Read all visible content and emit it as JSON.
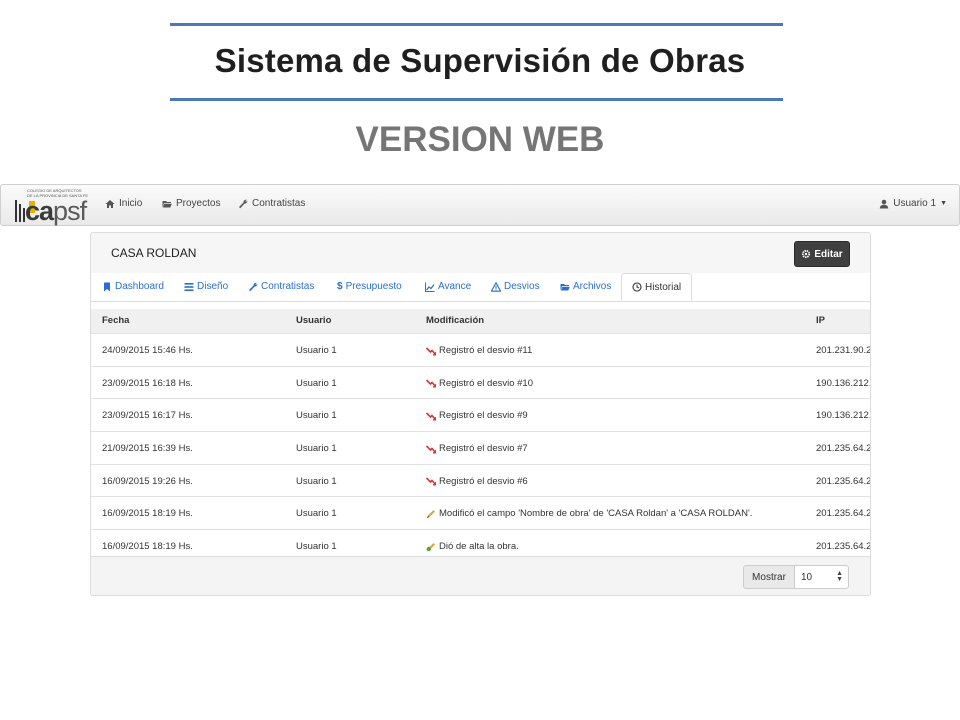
{
  "slide": {
    "title": "Sistema de Supervisión de Obras",
    "subtitle": "VERSION WEB"
  },
  "navbar": {
    "logo_text_main": "ca",
    "logo_text_sub": "psf",
    "logo_small_1": "COLEGIO DE ARQUITECTOS",
    "logo_small_2": "DE LA PROVINCIA DE SANTA FE",
    "items": [
      {
        "label": "Inicio",
        "icon": "home-icon"
      },
      {
        "label": "Proyectos",
        "icon": "folder-open-icon"
      },
      {
        "label": "Contratistas",
        "icon": "wrench-icon"
      }
    ],
    "user_label": "Usuario 1"
  },
  "panel": {
    "project_name": "CASA ROLDAN",
    "edit_label": "Editar",
    "tabs": [
      {
        "label": "Dashboard",
        "icon": "bookmark-icon"
      },
      {
        "label": "Diseño",
        "icon": "list-icon"
      },
      {
        "label": "Contratistas",
        "icon": "wrench-icon"
      },
      {
        "label": "Presupuesto",
        "icon": "dollar-icon"
      },
      {
        "label": "Avance",
        "icon": "chart-line-icon"
      },
      {
        "label": "Desvios",
        "icon": "warning-icon"
      },
      {
        "label": "Archivos",
        "icon": "folder-open-icon"
      },
      {
        "label": "Historial",
        "icon": "clock-icon"
      }
    ],
    "active_tab": "Historial",
    "table": {
      "headers": [
        "Fecha",
        "Usuario",
        "Modificación",
        "IP"
      ],
      "rows": [
        {
          "fecha": "24/09/2015 15:46 Hs.",
          "usuario": "Usuario 1",
          "modificacion": "Registró el desvio #11",
          "ip": "201.231.90.2",
          "icon": "desvio-icon"
        },
        {
          "fecha": "23/09/2015 16:18 Hs.",
          "usuario": "Usuario 1",
          "modificacion": "Registró el desvio #10",
          "ip": "190.136.212.",
          "icon": "desvio-icon"
        },
        {
          "fecha": "23/09/2015 16:17 Hs.",
          "usuario": "Usuario 1",
          "modificacion": "Registró el desvio #9",
          "ip": "190.136.212.",
          "icon": "desvio-icon"
        },
        {
          "fecha": "21/09/2015 16:39 Hs.",
          "usuario": "Usuario 1",
          "modificacion": "Registró el desvio #7",
          "ip": "201.235.64.2",
          "icon": "desvio-icon"
        },
        {
          "fecha": "16/09/2015 19:26 Hs.",
          "usuario": "Usuario 1",
          "modificacion": "Registró el desvio #6",
          "ip": "201.235.64.2",
          "icon": "desvio-icon"
        },
        {
          "fecha": "16/09/2015 18:19 Hs.",
          "usuario": "Usuario 1",
          "modificacion": "Modificó el campo 'Nombre de obra' de 'CASA Roldan' a 'CASA ROLDAN'.",
          "ip": "201.235.64.2",
          "icon": "pencil-icon"
        },
        {
          "fecha": "16/09/2015 18:19 Hs.",
          "usuario": "Usuario 1",
          "modificacion": "Dió de alta la obra.",
          "ip": "201.235.64.2",
          "icon": "create-icon"
        }
      ]
    },
    "footer": {
      "show_label": "Mostrar",
      "page_size": "10"
    }
  },
  "colors": {
    "rule_blue": "#4a7ab5",
    "tab_link": "#2a6fd0",
    "logo_accent": "#e7b100",
    "desvio_red": "#d9342b"
  }
}
